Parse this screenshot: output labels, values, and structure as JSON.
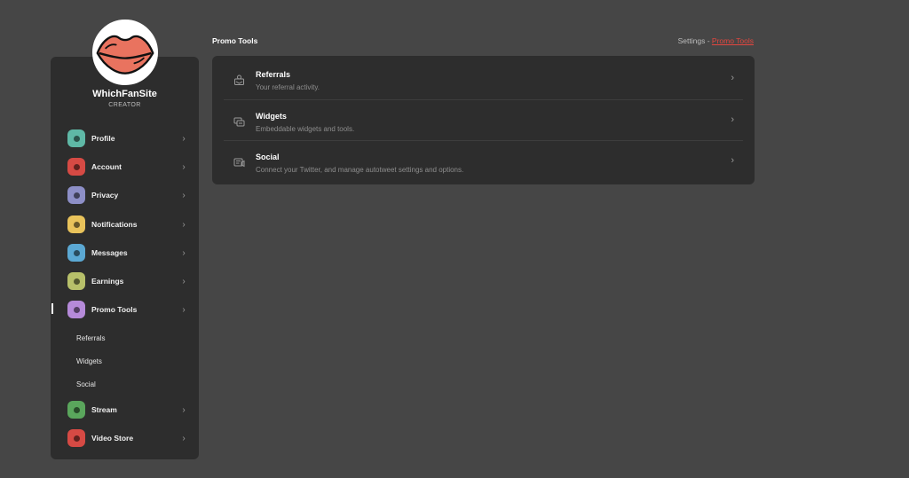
{
  "brand": {
    "name": "WhichFanSite",
    "role": "CREATOR"
  },
  "header": {
    "title": "Promo Tools",
    "breadcrumb": {
      "parent": "Settings",
      "separator": " - ",
      "current": "Promo Tools"
    }
  },
  "sidebar": {
    "items": [
      {
        "label": "Profile",
        "icon": "user-icon",
        "color": "#5fb8a6"
      },
      {
        "label": "Account",
        "icon": "account-icon",
        "color": "#d64a44"
      },
      {
        "label": "Privacy",
        "icon": "lock-icon",
        "color": "#8d8fc7"
      },
      {
        "label": "Notifications",
        "icon": "bell-icon",
        "color": "#e9c35b"
      },
      {
        "label": "Messages",
        "icon": "chat-icon",
        "color": "#5ba8d3"
      },
      {
        "label": "Earnings",
        "icon": "earnings-icon",
        "color": "#b7c06a"
      },
      {
        "label": "Promo Tools",
        "icon": "promo-icon",
        "color": "#b58ad9"
      },
      {
        "label": "Stream",
        "icon": "stream-icon",
        "color": "#5aa65c"
      },
      {
        "label": "Video Store",
        "icon": "video-store-icon",
        "color": "#d64a44"
      }
    ],
    "sub_items": [
      "Referrals",
      "Widgets",
      "Social"
    ],
    "chevron": "›"
  },
  "main": {
    "rows": [
      {
        "title": "Referrals",
        "desc": "Your referral activity.",
        "icon": "referral-icon"
      },
      {
        "title": "Widgets",
        "desc": "Embeddable widgets and tools.",
        "icon": "widgets-icon"
      },
      {
        "title": "Social",
        "desc": "Connect your Twitter, and manage autotweet settings and options.",
        "icon": "social-icon"
      }
    ],
    "chevron": "›"
  },
  "colors": {
    "background": "#464646",
    "panel": "#2d2d2d",
    "accent": "#e4463f"
  }
}
